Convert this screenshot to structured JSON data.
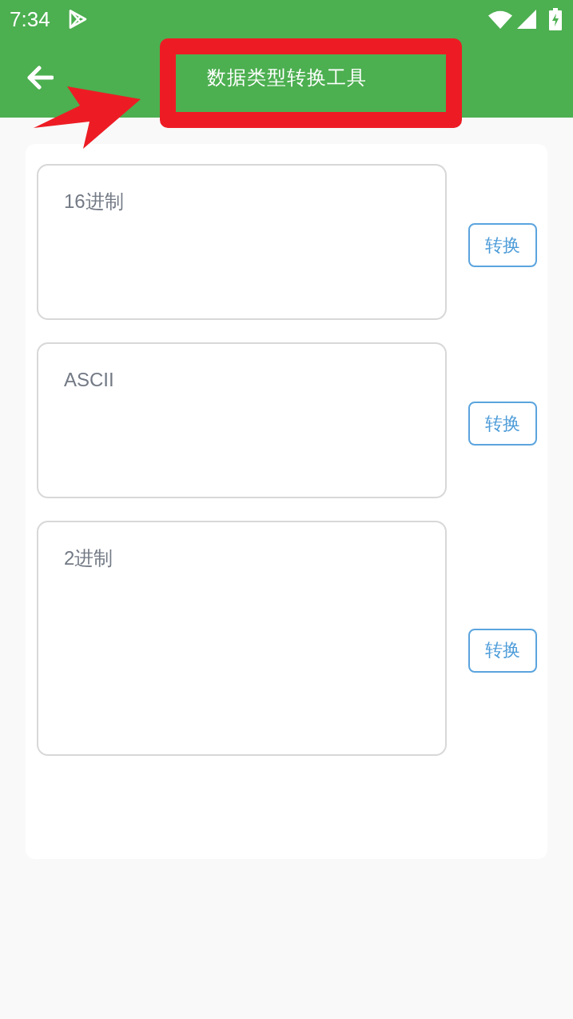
{
  "status_bar": {
    "time": "7:34"
  },
  "toolbar": {
    "title": "数据类型转换工具"
  },
  "fields": [
    {
      "placeholder": "16进制",
      "kind": "compact",
      "button": "转换"
    },
    {
      "placeholder": "ASCII",
      "kind": "compact",
      "button": "转换"
    },
    {
      "placeholder": "2进制",
      "kind": "tall",
      "button": "转换"
    }
  ]
}
